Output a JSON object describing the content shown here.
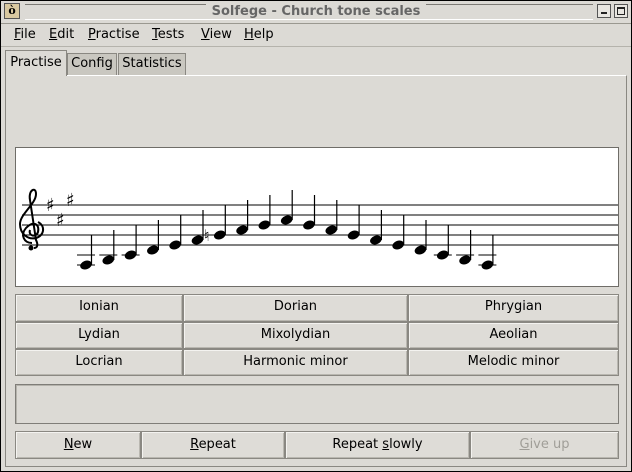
{
  "window": {
    "title": "Solfege - Church tone scales",
    "app_icon_glyph": "ò",
    "minimize_icon": "minimize-icon",
    "maximize_icon": "maximize-icon"
  },
  "menubar": [
    {
      "pre": "",
      "mnemonic": "F",
      "post": "ile"
    },
    {
      "pre": "",
      "mnemonic": "E",
      "post": "dit"
    },
    {
      "pre": "",
      "mnemonic": "P",
      "post": "ractise"
    },
    {
      "pre": "",
      "mnemonic": "T",
      "post": "ests"
    },
    {
      "pre": "",
      "mnemonic": "V",
      "post": "iew"
    },
    {
      "pre": "",
      "mnemonic": "H",
      "post": "elp"
    }
  ],
  "tabs": [
    {
      "label": "Practise",
      "active": true
    },
    {
      "label": "Config",
      "active": false
    },
    {
      "label": "Statistics",
      "active": false
    }
  ],
  "staff": {
    "clef": "treble-clef",
    "key_signature": "3 sharps",
    "notes": [
      "A",
      "B",
      "C#",
      "D",
      "E",
      "F#",
      "G",
      "A",
      "B",
      "C#",
      "D",
      "E",
      "F#",
      "G",
      "A",
      "B",
      "C#",
      "D",
      "E"
    ],
    "accidentals": [
      {
        "note_index": 6,
        "type": "natural"
      }
    ]
  },
  "answer_buttons": [
    [
      "Ionian",
      "Dorian",
      "Phrygian"
    ],
    [
      "Lydian",
      "Mixolydian",
      "Aeolian"
    ],
    [
      "Locrian",
      "Harmonic minor",
      "Melodic minor"
    ]
  ],
  "message": "",
  "actions": {
    "new": {
      "mnemonic": "N",
      "rest": "ew"
    },
    "repeat": {
      "mnemonic": "R",
      "rest": "epeat"
    },
    "repeat_slowly": {
      "pre": "Repeat ",
      "mnemonic": "s",
      "rest": "lowly"
    },
    "give_up": {
      "mnemonic": "G",
      "rest": "ive up",
      "disabled": true
    }
  }
}
